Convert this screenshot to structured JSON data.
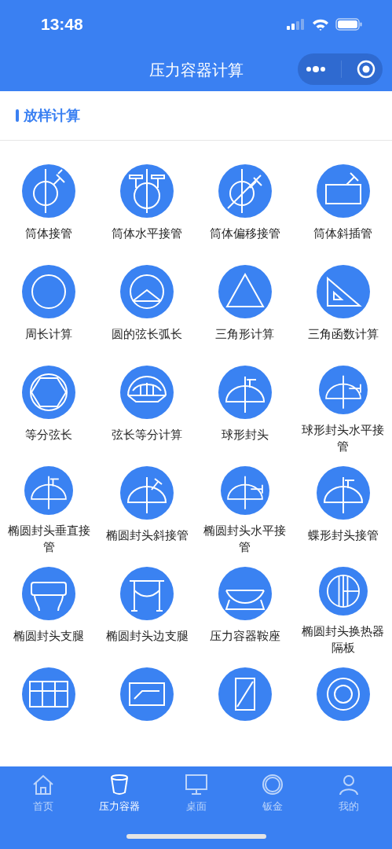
{
  "status_bar": {
    "time": "13:48"
  },
  "nav": {
    "title": "压力容器计算"
  },
  "section": {
    "title": "放样计算"
  },
  "tools": [
    {
      "label": "筒体接管",
      "kind": "shell-nozzle"
    },
    {
      "label": "筒体水平接管",
      "kind": "shell-flanges"
    },
    {
      "label": "筒体偏移接管",
      "kind": "shell-offset"
    },
    {
      "label": "筒体斜插管",
      "kind": "box-nozzle"
    },
    {
      "label": "周长计算",
      "kind": "ring"
    },
    {
      "label": "圆的弦长弧长",
      "kind": "chord"
    },
    {
      "label": "三角形计算",
      "kind": "triangle"
    },
    {
      "label": "三角函数计算",
      "kind": "set-square"
    },
    {
      "label": "等分弦长",
      "kind": "hexagon"
    },
    {
      "label": "弦长等分计算",
      "kind": "arch"
    },
    {
      "label": "球形封头",
      "kind": "head-vertical"
    },
    {
      "label": "球形封头水平接管",
      "kind": "head-horizontal"
    },
    {
      "label": "椭圆封头垂直接管",
      "kind": "head-vertical"
    },
    {
      "label": "椭圆封头斜接管",
      "kind": "head-oblique"
    },
    {
      "label": "椭圆封头水平接管",
      "kind": "head-horizontal"
    },
    {
      "label": "蝶形封头接管",
      "kind": "head-vertical"
    },
    {
      "label": "椭圆封头支腿",
      "kind": "legs"
    },
    {
      "label": "椭圆封头边支腿",
      "kind": "side-legs"
    },
    {
      "label": "压力容器鞍座",
      "kind": "saddle"
    },
    {
      "label": "椭圆封头换热器隔板",
      "kind": "baffle"
    },
    {
      "kind": "grid"
    },
    {
      "kind": "slot"
    },
    {
      "kind": "slash-box"
    },
    {
      "kind": "double-ring"
    }
  ],
  "tab_bar": [
    {
      "label": "首页",
      "kind": "home",
      "selected": false
    },
    {
      "label": "压力容器",
      "kind": "vessel",
      "selected": true
    },
    {
      "label": "桌面",
      "kind": "desk",
      "selected": false
    },
    {
      "label": "钣金",
      "kind": "ring",
      "selected": false
    },
    {
      "label": "我的",
      "kind": "person",
      "selected": false
    }
  ]
}
